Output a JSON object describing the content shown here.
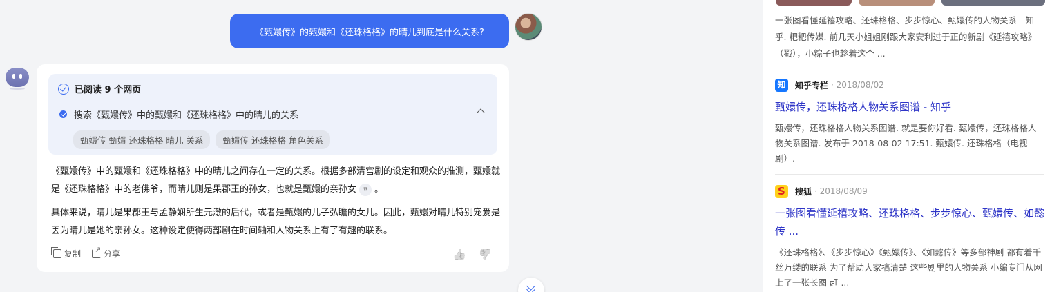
{
  "user_message": "《甄嬛传》的甄嬛和《还珠格格》的晴儿到底是什么关系?",
  "answer": {
    "read_title": "已阅读 9 个网页",
    "search_query": "搜索《甄嬛传》中的甄嬛和《还珠格格》中的晴儿的关系",
    "search_tags": [
      "甄嬛传 甄嬛 还珠格格 晴儿 关系",
      "甄嬛传 还珠格格 角色关系"
    ],
    "paragraph1": "《甄嬛传》中的甄嬛和《还珠格格》中的晴儿之间存在一定的关系。根据多部清宫剧的设定和观众的推测，甄嬛就是《还珠格格》中的老佛爷，而晴儿则是果郡王的孙女，也就是甄嬛的亲孙女",
    "paragraph1_end": "。",
    "citation_glyph": "❞",
    "paragraph2": "具体来说，晴儿是果郡王与孟静娴所生元澈的后代，或者是甄嬛的儿子弘瞻的女儿。因此，甄嬛对晴儿特别宠爱是因为晴儿是她的亲孙女。这种设定使得两部剧在时间轴和人物关系上有了有趣的联系。",
    "copy_label": "复制",
    "share_label": "分享",
    "like_glyph": "👍",
    "dislike_glyph": "👍"
  },
  "sources": {
    "top_snippet": "一张图看懂延禧攻略、还珠格格、步步惊心、甄嬛传的人物关系 - 知乎. 粑粑传媒. 前几天小姐姐刚跟大家安利过于正的新剧《延禧攻略》（戳），小粽子也趁着这个 ...",
    "items": [
      {
        "icon": "zhihu-icon",
        "icon_text": "知",
        "site": "知乎专栏",
        "date": "· 2018/08/02",
        "title": "甄嬛传，还珠格格人物关系图谱 - 知乎",
        "snippet": "甄嬛传，还珠格格人物关系图谱. 就是要你好看. 甄嬛传，还珠格格人物关系图谱. 发布于 2018-08-02 17:51. 甄嬛传. 还珠格格（电视剧）."
      },
      {
        "icon": "sohu-icon",
        "site": "搜狐",
        "date": "· 2018/08/09",
        "title": "一张图看懂延禧攻略、还珠格格、步步惊心、甄嬛传、如懿传 ...",
        "snippet": "《还珠格格》、《步步惊心》《甄嬛传》、《如懿传》等多部神剧 都有着千丝万缕的联系 为了帮助大家搞清楚 这些剧里的人物关系 小编专门从网上了一张长图 赶 ..."
      }
    ]
  },
  "colors": {
    "accent": "#3c6cf0",
    "link": "#2e35c7",
    "background": "#f3f4f6"
  }
}
